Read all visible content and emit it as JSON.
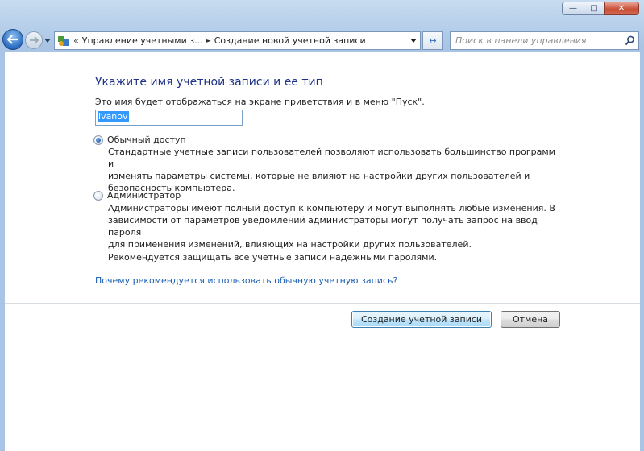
{
  "window": {
    "minimize_glyph": "—",
    "maximize_glyph": "□",
    "close_glyph": "✕"
  },
  "nav": {
    "address": {
      "overflow_glyph": "«",
      "crumb1": "Управление учетными з...",
      "separator": "►",
      "crumb2": "Создание новой учетной записи"
    },
    "refresh_glyph": "↔",
    "search_placeholder": "Поиск в панели управления"
  },
  "content": {
    "title": "Укажите имя учетной записи и ее тип",
    "description": "Это имя будет отображаться на экране приветствия и в меню \"Пуск\".",
    "name_value": "ivanov",
    "options": [
      {
        "label": "Обычный доступ",
        "selected": true,
        "lines": [
          "Стандартные учетные записи пользователей позволяют использовать большинство программ и",
          "изменять параметры системы, которые не влияют на настройки других пользователей и",
          "безопасность компьютера."
        ]
      },
      {
        "label": "Администратор",
        "selected": false,
        "lines": [
          "Администраторы имеют полный доступ к компьютеру и могут выполнять любые изменения. В",
          "зависимости от параметров уведомлений администраторы могут получать запрос на ввод пароля",
          "для применения изменений, влияющих на настройки других пользователей."
        ]
      }
    ],
    "recommendation": "Рекомендуется защищать все учетные записи надежными паролями.",
    "why_link": "Почему рекомендуется использовать обычную учетную запись?"
  },
  "buttons": {
    "create": "Создание учетной записи",
    "cancel": "Отмена"
  },
  "colors": {
    "title": "#1e3287",
    "link": "#1a5fb4",
    "selection": "#3399ff"
  }
}
